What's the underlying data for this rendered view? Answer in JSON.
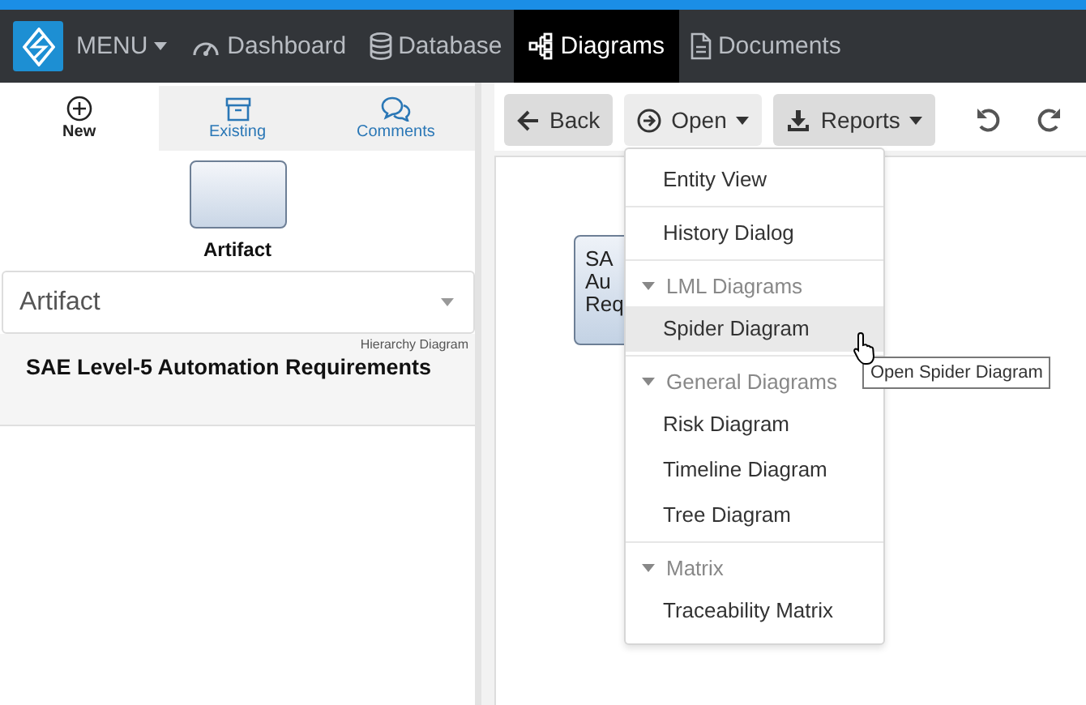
{
  "nav": {
    "menu_label": "MENU",
    "items": [
      {
        "label": "Dashboard",
        "selected": false
      },
      {
        "label": "Database",
        "selected": false
      },
      {
        "label": "Diagrams",
        "selected": true
      },
      {
        "label": "Documents",
        "selected": false
      }
    ]
  },
  "sidebar": {
    "tabs": [
      {
        "label": "New",
        "selected": true
      },
      {
        "label": "Existing",
        "selected": false
      },
      {
        "label": "Comments",
        "selected": false
      }
    ],
    "palette_label": "Artifact",
    "type_select": {
      "value": "Artifact"
    },
    "result": {
      "type": "Hierarchy Diagram",
      "title": "SAE Level-5 Automation Requirements"
    }
  },
  "toolbar": {
    "buttons": [
      {
        "label": "Back",
        "pressed": false,
        "caret": false
      },
      {
        "label": "Open",
        "pressed": true,
        "caret": true
      },
      {
        "label": "Reports",
        "pressed": false,
        "caret": true
      }
    ]
  },
  "canvas": {
    "node_lines": [
      "SA",
      "Au",
      "Req"
    ]
  },
  "menu": {
    "groups": [
      {
        "items": [
          {
            "label": "Entity View",
            "selected": false
          }
        ]
      },
      {
        "items": [
          {
            "label": "History Dialog",
            "selected": false
          }
        ]
      },
      {
        "header": "LML Diagrams",
        "items": [
          {
            "label": "Spider Diagram",
            "selected": true
          }
        ]
      },
      {
        "header": "General Diagrams",
        "items": [
          {
            "label": "Risk Diagram",
            "selected": false
          },
          {
            "label": "Timeline Diagram",
            "selected": false
          },
          {
            "label": "Tree Diagram",
            "selected": false
          }
        ]
      },
      {
        "header": "Matrix",
        "items": [
          {
            "label": "Traceability Matrix",
            "selected": false
          }
        ]
      }
    ]
  },
  "tooltip": "Open Spider Diagram"
}
